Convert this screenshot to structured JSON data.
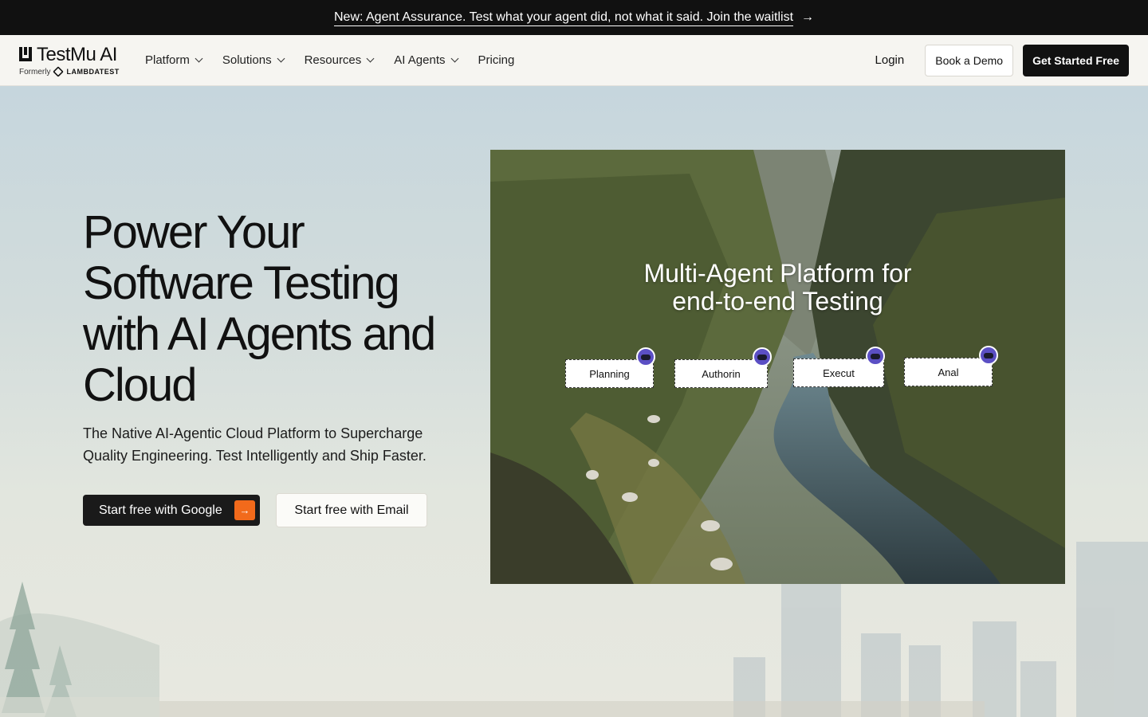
{
  "announcement": {
    "text": "New: Agent Assurance. Test what your agent did, not what it said. Join the waitlist",
    "arrow": "→"
  },
  "nav": {
    "logo_name": "TestMu AI",
    "logo_formerly": "Formerly",
    "logo_former_brand": "LAMBDATEST",
    "items": [
      {
        "label": "Platform",
        "dropdown": true
      },
      {
        "label": "Solutions",
        "dropdown": true
      },
      {
        "label": "Resources",
        "dropdown": true
      },
      {
        "label": "AI Agents",
        "dropdown": true
      },
      {
        "label": "Pricing",
        "dropdown": false
      }
    ],
    "login": "Login",
    "book_demo": "Book a Demo",
    "get_started": "Get Started Free"
  },
  "hero": {
    "headline": "Power Your Software Testing with AI Agents and Cloud",
    "subtext": "The Native AI-Agentic Cloud Platform to Supercharge Quality Engineering. Test Intelligently and Ship Faster.",
    "cta_google": "Start free with Google",
    "cta_email": "Start free with Email"
  },
  "media": {
    "title_line1": "Multi-Agent Platform for",
    "title_line2": "end-to-end Testing",
    "chips": [
      "Planning",
      "Authorin",
      "Execut",
      "Anal"
    ]
  },
  "colors": {
    "accent": "#f26a1b",
    "dark": "#111111",
    "announce_bg": "#111111"
  }
}
